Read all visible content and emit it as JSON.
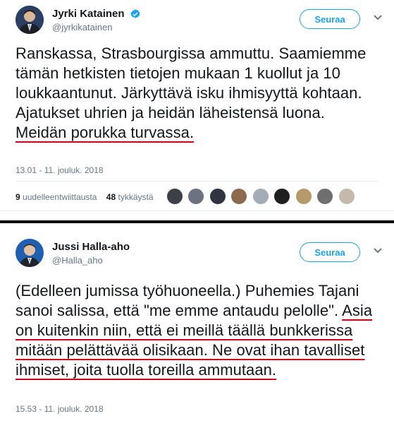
{
  "tweets": [
    {
      "author": "Jyrki Katainen",
      "handle": "@jyrkikatainen",
      "verified": true,
      "follow_label": "Seuraa",
      "text_plain": "Ranskassa, Strasbourgissa ammuttu. Saamiemme tämän hetkisten tietojen mukaan 1 kuollut ja 10 loukkaantunut. Järkyttävä isku ihmisyyttä kohtaan. Ajatukset uhrien ja heidän läheistensä luona. ",
      "text_underlined": "Meidän porukka turvassa.",
      "timestamp": "13.01 - 11. jouluk. 2018",
      "retweets_count": "9",
      "retweets_label": "uudelleentwiittausta",
      "likes_count": "48",
      "likes_label": "tykkäystä"
    },
    {
      "author": "Jussi Halla-aho",
      "handle": "@Halla_aho",
      "verified": false,
      "follow_label": "Seuraa",
      "text_plain": "(Edelleen jumissa työhuoneella.) Puhemies Tajani sanoi salissa, että \"me emme antaudu pelolle\". ",
      "text_underlined": "Asia on kuitenkin niin, että ei meillä täällä bunkkerissa mitään pelättävää olisikaan. Ne ovat ihan tavalliset ihmiset, joita tuolla toreilla ammutaan.",
      "timestamp": "15.53 - 11. jouluk. 2018"
    }
  ],
  "colors": {
    "accent": "#1da1f2",
    "underline": "#d0021b",
    "muted": "#657786",
    "divider": "#000000"
  },
  "icons": [
    "verified-badge-icon",
    "chevron-down-icon",
    "avatar"
  ]
}
